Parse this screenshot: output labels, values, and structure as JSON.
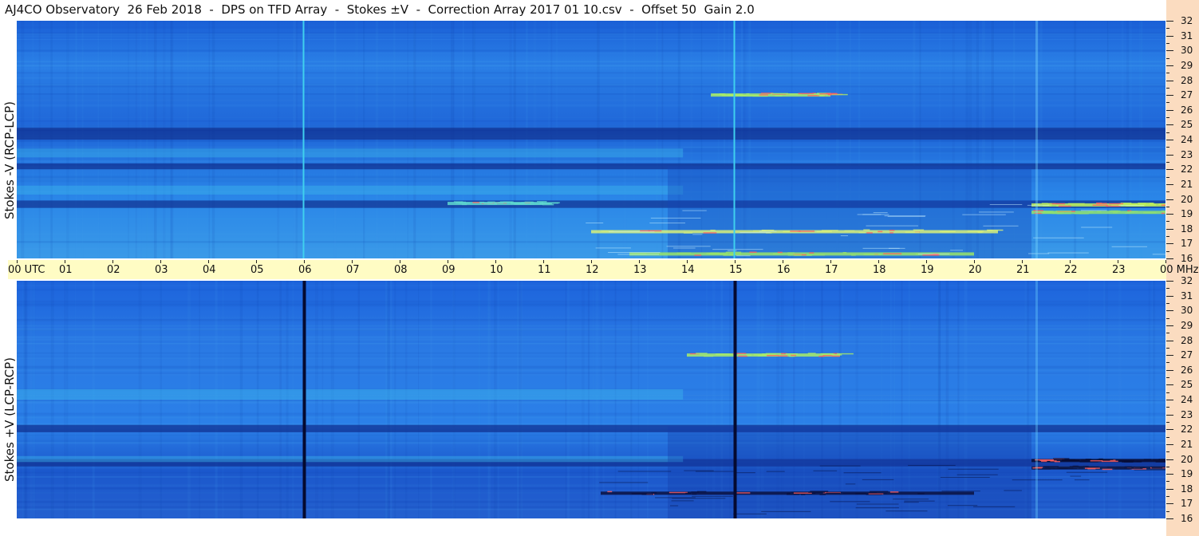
{
  "title": "AJ4CO Observatory  26 Feb 2018  -  DPS on TFD Array  -  Stokes ±V  -  Correction Array 2017 01 10.csv  -  Offset 50  Gain 2.0",
  "colors": {
    "background_blue": "#1f6fe0",
    "dark_band": "#123fa0",
    "bright_band": "#39b6e8",
    "emission": "#b7f25a",
    "time_axis_bg": "#fffcc4",
    "freq_strip_bg": "#fbdcc0"
  },
  "chart_data": [
    {
      "type": "heatmap",
      "panel": "top",
      "ylabel": "Stokes -V (RCP-LCP)",
      "x_ticks": [
        "00 UTC",
        "01",
        "02",
        "03",
        "04",
        "05",
        "06",
        "07",
        "08",
        "09",
        "10",
        "11",
        "12",
        "13",
        "14",
        "15",
        "16",
        "17",
        "18",
        "19",
        "20",
        "21",
        "22",
        "23",
        "00 MHz"
      ],
      "y_ticks": [
        "32",
        "31",
        "30",
        "29",
        "28",
        "27",
        "26",
        "25",
        "24",
        "23",
        "22",
        "21",
        "20",
        "19",
        "18",
        "17",
        "16"
      ],
      "xlim_utc_hours": [
        0,
        24
      ],
      "ylim_mhz": [
        16,
        32
      ],
      "features": {
        "vertical_lines_utc": [
          6.0,
          15.0
        ],
        "vertical_line_color": "#3fd0ee",
        "dark_bands_mhz": [
          [
            24.0,
            24.8
          ],
          [
            22.0,
            22.4
          ],
          [
            19.4,
            19.9
          ]
        ],
        "bright_bands_mhz": [
          [
            22.8,
            23.4
          ],
          [
            20.3,
            20.9
          ]
        ],
        "emission_segments": [
          {
            "t_start": 12.0,
            "t_end": 20.5,
            "mhz": 17.8,
            "color": "#d7f07a"
          },
          {
            "t_start": 12.8,
            "t_end": 20.0,
            "mhz": 16.3,
            "color": "#9ae46a"
          },
          {
            "t_start": 14.5,
            "t_end": 17.0,
            "mhz": 27.0,
            "color": "#a8ec6a"
          },
          {
            "t_start": 21.2,
            "t_end": 24.0,
            "mhz": 19.6,
            "color": "#c2f25a"
          },
          {
            "t_start": 21.2,
            "t_end": 24.0,
            "mhz": 19.1,
            "color": "#8fe070"
          },
          {
            "t_start": 9.0,
            "t_end": 11.0,
            "mhz": 19.7,
            "color": "#5fd8d0"
          }
        ]
      }
    },
    {
      "type": "heatmap",
      "panel": "bottom",
      "ylabel": "Stokes +V (LCP-RCP)",
      "x_ticks": [
        "00 UTC",
        "01",
        "02",
        "03",
        "04",
        "05",
        "06",
        "07",
        "08",
        "09",
        "10",
        "11",
        "12",
        "13",
        "14",
        "15",
        "16",
        "17",
        "18",
        "19",
        "20",
        "21",
        "22",
        "23",
        "00 MHz"
      ],
      "y_ticks": [
        "32",
        "31",
        "30",
        "29",
        "28",
        "27",
        "26",
        "25",
        "24",
        "23",
        "22",
        "21",
        "20",
        "19",
        "18",
        "17",
        "16"
      ],
      "xlim_utc_hours": [
        0,
        24
      ],
      "ylim_mhz": [
        16,
        32
      ],
      "features": {
        "vertical_lines_utc": [
          6.0,
          15.0
        ],
        "vertical_line_color": "#050a30",
        "dark_bands_mhz": [
          [
            21.8,
            22.3
          ],
          [
            19.5,
            20.0
          ]
        ],
        "bright_bands_mhz": [
          [
            24.0,
            24.7
          ],
          [
            19.8,
            20.2
          ]
        ],
        "emission_segments": [
          {
            "t_start": 12.2,
            "t_end": 20.0,
            "mhz": 17.7,
            "color": "#0a1040"
          },
          {
            "t_start": 14.0,
            "t_end": 17.2,
            "mhz": 27.0,
            "color": "#a8ec6a"
          },
          {
            "t_start": 21.2,
            "t_end": 24.0,
            "mhz": 19.9,
            "color": "#070c34"
          },
          {
            "t_start": 21.2,
            "t_end": 24.0,
            "mhz": 19.4,
            "color": "#0d1848"
          }
        ]
      }
    }
  ]
}
